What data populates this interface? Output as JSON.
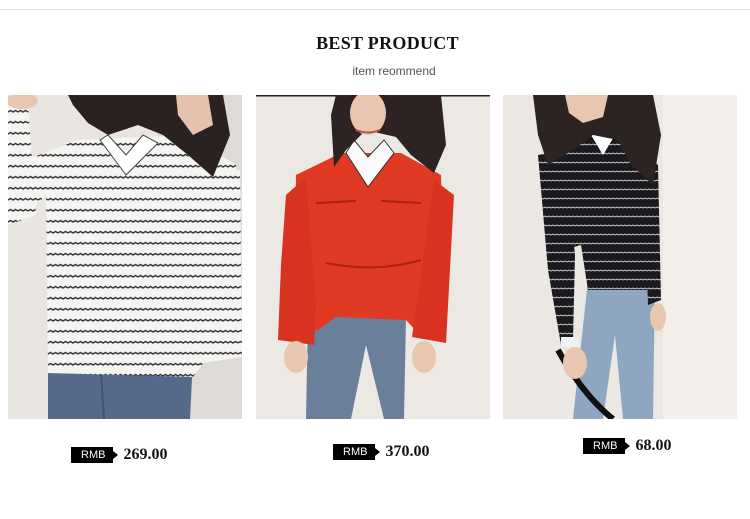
{
  "section": {
    "title": "BEST PRODUCT",
    "subtitle": "item reommend"
  },
  "products": [
    {
      "currency": "RMB",
      "price": "269.00",
      "image_subject": "white striped sweater with collar and blue jeans"
    },
    {
      "currency": "RMB",
      "price": "370.00",
      "image_subject": "red jacket with white collar and blue jeans"
    },
    {
      "currency": "RMB",
      "price": "68.00",
      "image_subject": "black striped sweater and light blue jeans"
    }
  ],
  "colors": {
    "price_tag": "#000000",
    "title": "#111111",
    "subtitle": "#555555"
  }
}
